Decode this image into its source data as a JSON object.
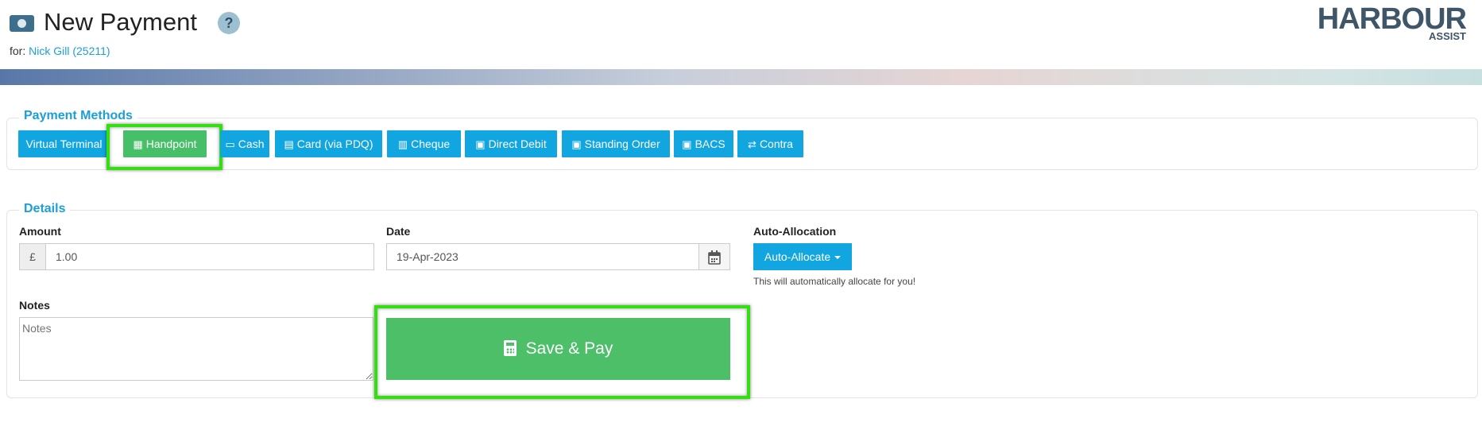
{
  "header": {
    "title": "New Payment",
    "help_label": "?",
    "for_label": "for:",
    "customer_link": "Nick Gill (25211)",
    "logo_main": "HARBOUR",
    "logo_sub": "ASSIST"
  },
  "payment_methods": {
    "legend": "Payment Methods",
    "buttons": [
      {
        "label": "Virtual Terminal",
        "icon": "none"
      },
      {
        "label": "Handpoint",
        "icon": "calculator-icon",
        "active": true
      },
      {
        "label": "Cash",
        "icon": "money-icon"
      },
      {
        "label": "Card (via PDQ)",
        "icon": "credit-card-icon"
      },
      {
        "label": "Cheque",
        "icon": "cheque-icon"
      },
      {
        "label": "Direct Debit",
        "icon": "calendar-icon"
      },
      {
        "label": "Standing Order",
        "icon": "calendar-icon"
      },
      {
        "label": "BACS",
        "icon": "calendar-icon"
      },
      {
        "label": "Contra",
        "icon": "exchange-icon"
      }
    ]
  },
  "details": {
    "legend": "Details",
    "amount_label": "Amount",
    "currency_symbol": "£",
    "amount_value": "1.00",
    "date_label": "Date",
    "date_value": "19-Apr-2023",
    "auto_allocation_label": "Auto-Allocation",
    "auto_allocate_button": "Auto-Allocate",
    "auto_allocate_help": "This will automatically allocate for you!",
    "notes_label": "Notes",
    "notes_placeholder": "Notes",
    "save_button": "Save & Pay"
  },
  "colors": {
    "accent": "#11a6df",
    "success": "#47bf68",
    "highlight": "#32e010"
  }
}
